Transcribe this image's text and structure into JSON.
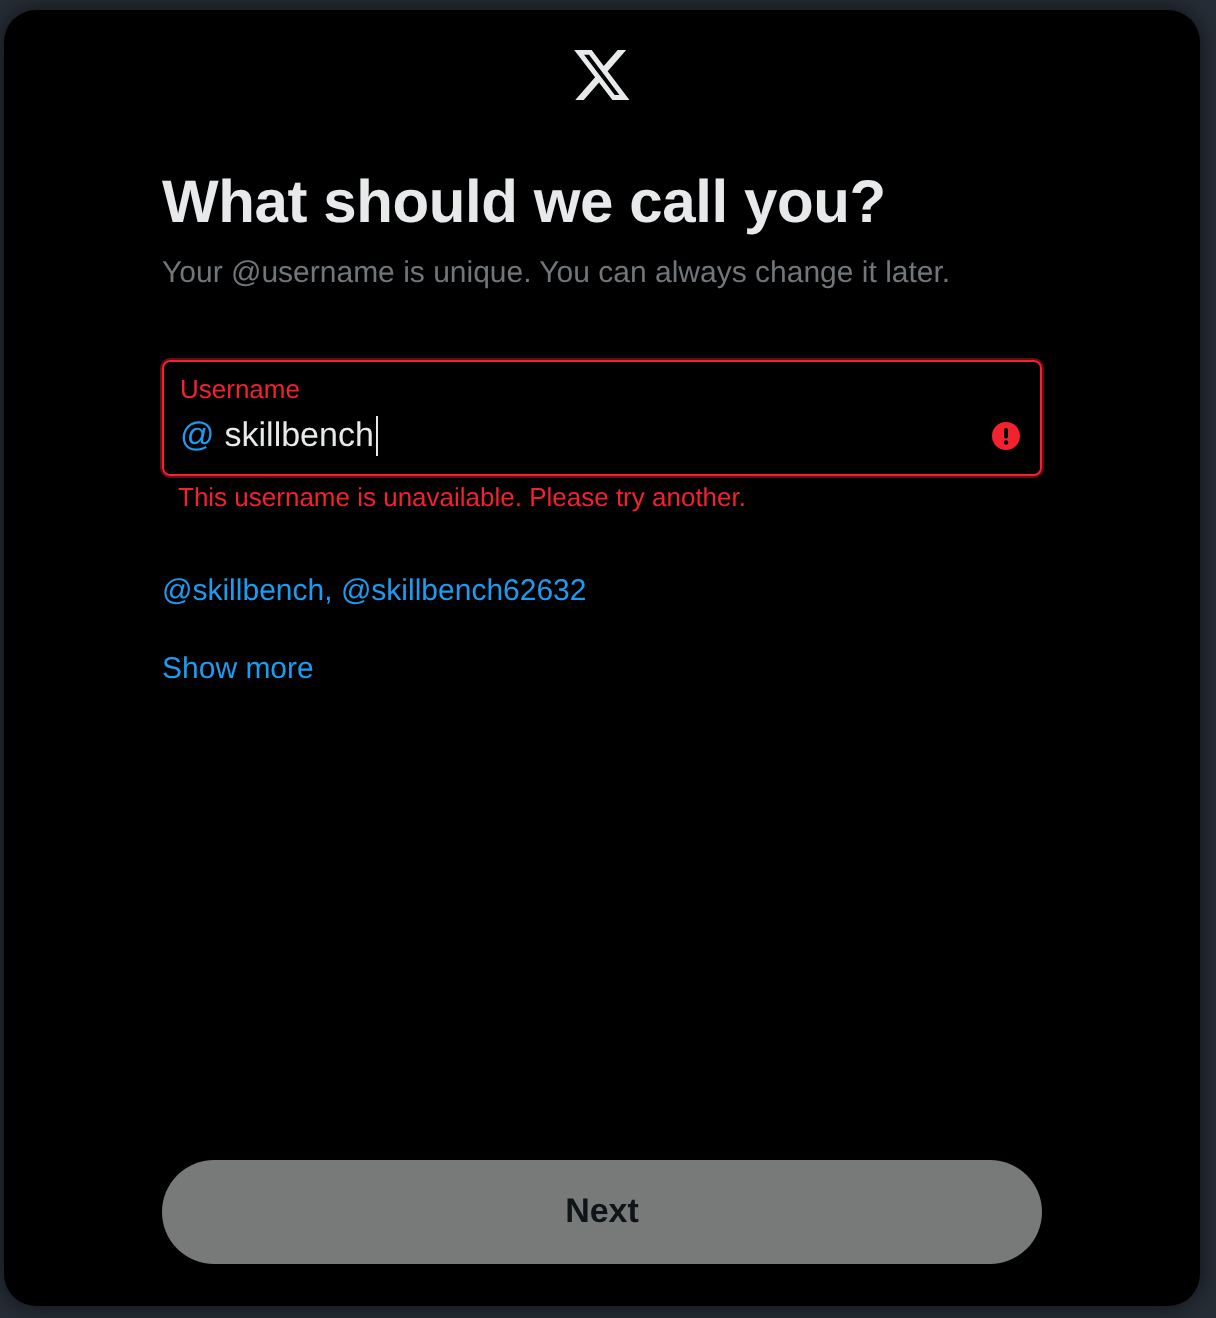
{
  "dialog": {
    "title": "What should we call you?",
    "subtitle": "Your @username is unique. You can always change it later."
  },
  "username_field": {
    "label": "Username",
    "prefix": "@",
    "value": "skillbench",
    "focused": true,
    "invalid": true,
    "error": "This username is unavailable. Please try another."
  },
  "suggestions": {
    "items": [
      "@skillbench",
      "@skillbench62632"
    ],
    "separator": ", "
  },
  "show_more": "Show more",
  "next_button": {
    "label": "Next",
    "disabled": true
  }
}
